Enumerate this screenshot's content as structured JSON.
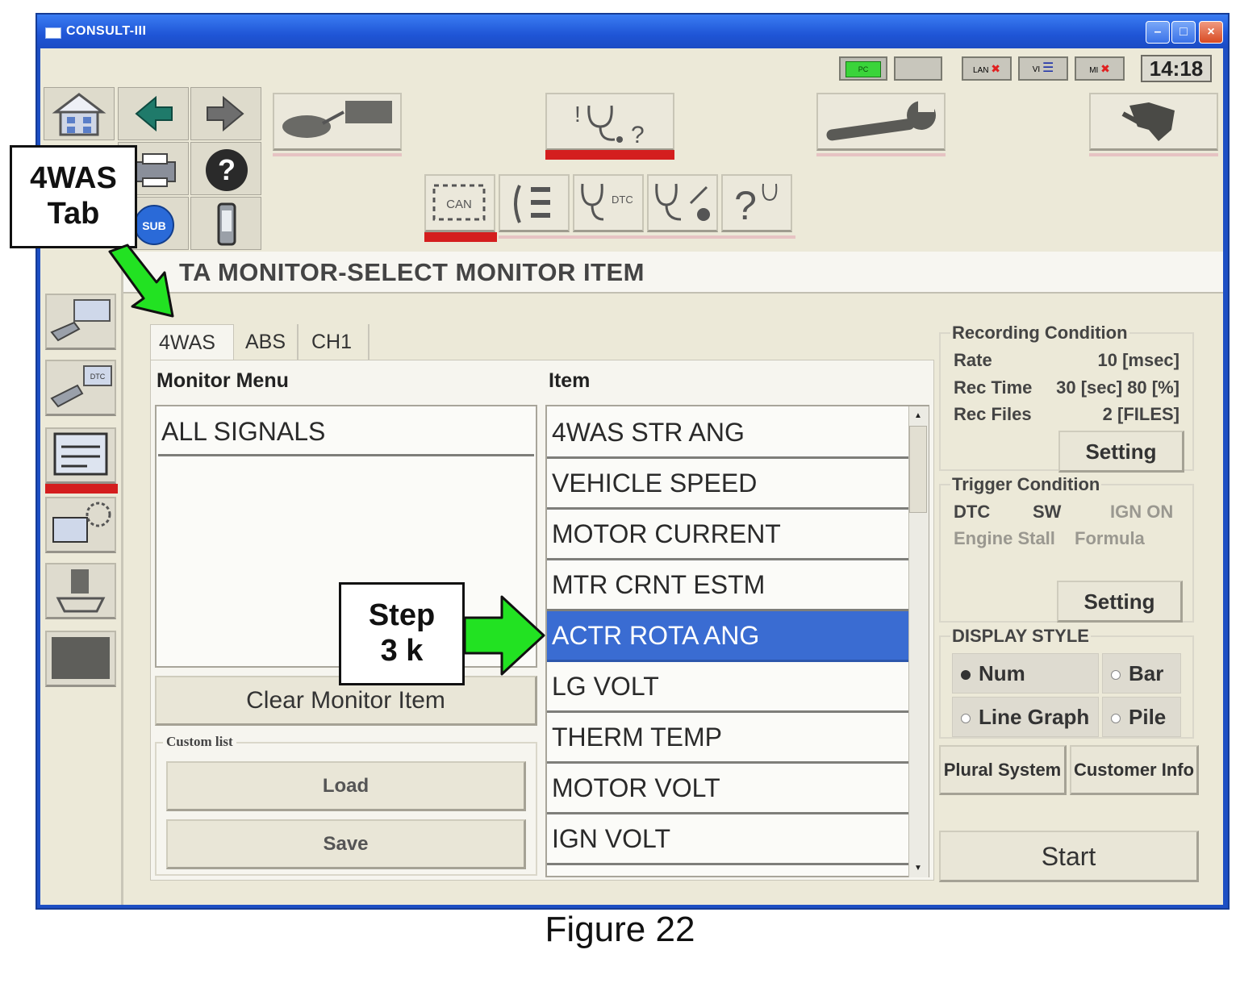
{
  "window": {
    "title": "CONSULT-III"
  },
  "status": {
    "clock": "14:18",
    "lan": "LAN",
    "vi": "VI",
    "mi": "MI",
    "pc": "PC"
  },
  "header": {
    "title": "TA MONITOR-SELECT MONITOR ITEM"
  },
  "tabs": [
    {
      "label": "4WAS",
      "active": true
    },
    {
      "label": "ABS",
      "active": false
    },
    {
      "label": "CH1",
      "active": false
    }
  ],
  "monitor_menu": {
    "heading": "Monitor Menu",
    "items": [
      "ALL SIGNALS"
    ],
    "clear_button": "Clear Monitor Item",
    "custom_list": {
      "label": "Custom list",
      "load": "Load",
      "save": "Save"
    }
  },
  "item_list": {
    "heading": "Item",
    "items": [
      "4WAS STR ANG",
      "VEHICLE SPEED",
      "MOTOR CURRENT",
      "MTR CRNT ESTM",
      "ACTR ROTA ANG",
      "LG VOLT",
      "THERM TEMP",
      "MOTOR VOLT",
      "IGN VOLT"
    ],
    "selected": "ACTR ROTA ANG"
  },
  "recording_condition": {
    "title": "Recording Condition",
    "rate_label": "Rate",
    "rate_value": "10 [msec]",
    "rec_time_label": "Rec Time",
    "rec_time_value": "30 [sec] 80 [%]",
    "rec_files_label": "Rec Files",
    "rec_files_value": "2 [FILES]",
    "setting": "Setting"
  },
  "trigger_condition": {
    "title": "Trigger Condition",
    "dtc": "DTC",
    "sw": "SW",
    "ign_on": "IGN ON",
    "engine_stall": "Engine Stall",
    "formula": "Formula",
    "setting": "Setting"
  },
  "display_style": {
    "title": "DISPLAY STYLE",
    "num": "Num",
    "bar": "Bar",
    "line_graph": "Line Graph",
    "pile": "Pile",
    "selected": "Num"
  },
  "buttons": {
    "plural_system": "Plural System",
    "customer_info": "Customer Info",
    "start": "Start"
  },
  "callouts": {
    "tab_line1": "4WAS",
    "tab_line2": "Tab",
    "step_line1": "Step",
    "step_line2": "3 k"
  },
  "caption": "Figure 22",
  "icons": [
    "home-icon",
    "back-arrow-icon",
    "forward-arrow-icon",
    "printer-icon",
    "help-icon",
    "sub-icon",
    "phone-icon",
    "vehicle-connect-icon",
    "diagnosis-icon",
    "wrench-icon",
    "ecu-icon",
    "can-icon",
    "sort-icon",
    "dtc-icon",
    "stethoscope-icon",
    "question-icon"
  ],
  "colors": {
    "title_bar": "#1f55d6",
    "selection": "#3a6cd2",
    "active_indicator": "#d41e1e",
    "callout_arrow": "#22e222"
  }
}
